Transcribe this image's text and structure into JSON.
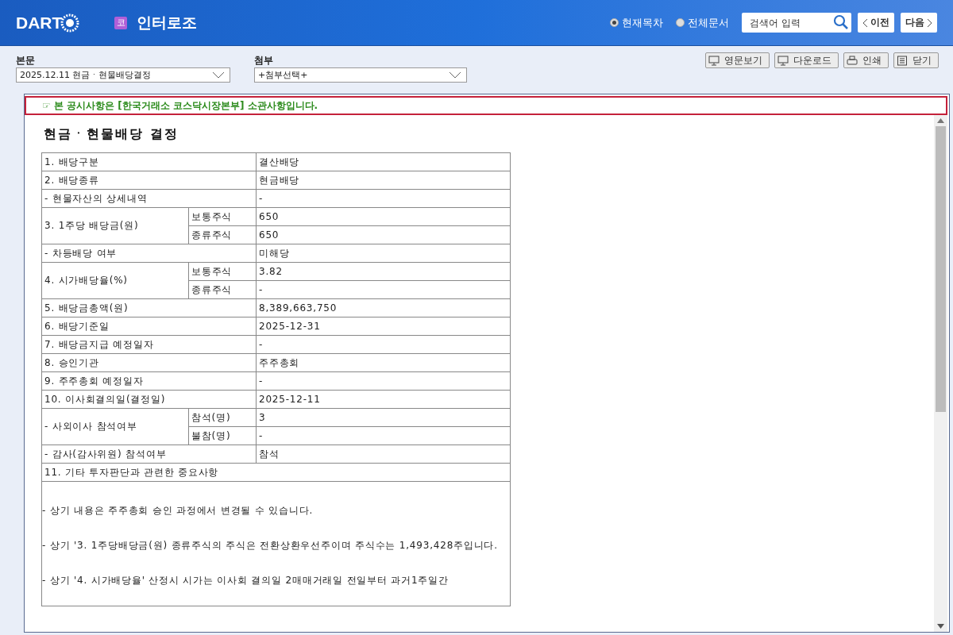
{
  "header": {
    "logo": "DART",
    "company_badge": "코",
    "company": "인터로조",
    "scope_options": [
      {
        "label": "현재목차",
        "selected": true
      },
      {
        "label": "전체문서",
        "selected": false
      }
    ],
    "search": {
      "placeholder": "검색어 입력"
    },
    "prev": "이전",
    "next": "다음"
  },
  "toolbar": {
    "main_label": "본문",
    "main_value": "2025.12.11  현금ㆍ현물배당결정",
    "attach_label": "첨부",
    "attach_value": "+첨부선택+",
    "buttons": [
      {
        "kind": "monitor",
        "label": "영문보기"
      },
      {
        "kind": "monitor",
        "label": "다운로드"
      },
      {
        "kind": "print",
        "label": "인쇄"
      },
      {
        "kind": "list",
        "label": "닫기"
      }
    ]
  },
  "notice": "☞ 본 공시사항은 [한국거래소 코스닥시장본부] 소관사항입니다.",
  "document": {
    "title": "현금ㆍ현물배당 결정",
    "rows": [
      {
        "kind": "plain",
        "label": "1. 배당구분",
        "value": "결산배당"
      },
      {
        "kind": "plain",
        "label": "2. 배당종류",
        "value": "현금배당"
      },
      {
        "kind": "plain",
        "label": "- 현물자산의 상세내역",
        "value": "-"
      },
      {
        "kind": "split",
        "label": "3. 1주당 배당금(원)",
        "parts": [
          {
            "sub": "보통주식",
            "value": "650"
          },
          {
            "sub": "종류주식",
            "value": "650"
          }
        ]
      },
      {
        "kind": "plain",
        "label": "- 차등배당 여부",
        "value": "미해당"
      },
      {
        "kind": "split",
        "label": "4. 시가배당율(%)",
        "parts": [
          {
            "sub": "보통주식",
            "value": "3.82"
          },
          {
            "sub": "종류주식",
            "value": "-"
          }
        ]
      },
      {
        "kind": "plain",
        "label": "5. 배당금총액(원)",
        "value": "8,389,663,750"
      },
      {
        "kind": "plain",
        "label": "6. 배당기준일",
        "value": "2025-12-31"
      },
      {
        "kind": "plain",
        "label": "7. 배당금지급 예정일자",
        "value": "-"
      },
      {
        "kind": "plain",
        "label": "8. 승인기관",
        "value": "주주총회"
      },
      {
        "kind": "plain",
        "label": "9. 주주총회 예정일자",
        "value": "-"
      },
      {
        "kind": "plain",
        "label": "10. 이사회결의일(결정일)",
        "value": "2025-12-11"
      },
      {
        "kind": "split",
        "label": "- 사외이사 참석여부",
        "parts": [
          {
            "sub": "참석(명)",
            "value": "3"
          },
          {
            "sub": "불참(명)",
            "value": "-"
          }
        ]
      },
      {
        "kind": "plain",
        "label": "- 감사(감사위원) 참석여부",
        "value": "참석"
      },
      {
        "kind": "full",
        "label": "11. 기타 투자판단과 관련한 중요사항"
      }
    ],
    "notes": [
      "- 상기 내용은 주주총회 승인 과정에서 변경될 수 있습니다.",
      "- 상기 '3. 1주당배당금(원) 종류주식의 주식은 전환상환우선주이며 주식수는 1,493,428주입니다.",
      "- 상기 '4. 시가배당율' 산정시 시가는 이사회 결의일 2매매거래일 전일부터 과거1주일간"
    ]
  }
}
